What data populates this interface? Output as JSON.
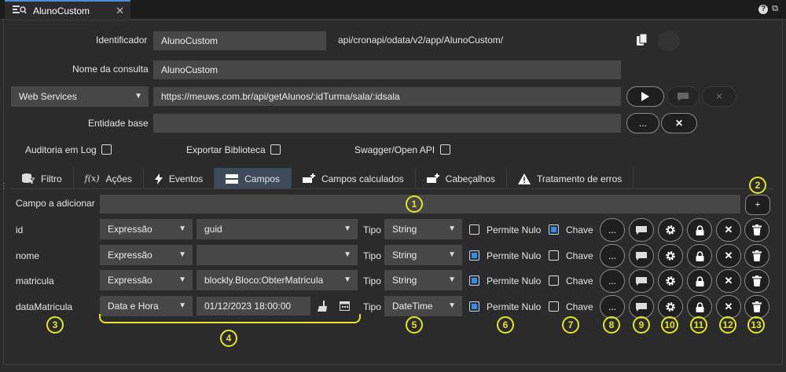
{
  "window": {
    "tab_title": "AlunoCustom",
    "help_icon": "help-icon",
    "external_icon": "external-link-icon"
  },
  "form": {
    "identificador_label": "Identificador",
    "identificador_value": "AlunoCustom",
    "api_path": "api/cronapi/odata/v2/app/AlunoCustom/",
    "nome_consulta_label": "Nome da consulta",
    "nome_consulta_value": "AlunoCustom",
    "source_type": "Web Services",
    "url_value": "https://meuws.com.br/api/getAlunos/:idTurma/sala/:idsala",
    "entidade_label": "Entidade base",
    "entidade_value": "",
    "ellipsis_label": "...",
    "auditoria_label": "Auditoria em Log",
    "exportar_label": "Exportar Biblioteca",
    "swagger_label": "Swagger/Open API"
  },
  "tabs": [
    {
      "label": "Filtro",
      "icon": "database-filter-icon"
    },
    {
      "label": "Ações",
      "icon": "function-icon"
    },
    {
      "label": "Eventos",
      "icon": "lightning-icon"
    },
    {
      "label": "Campos",
      "icon": "fields-icon"
    },
    {
      "label": "Campos calculados",
      "icon": "add-field-icon"
    },
    {
      "label": "Cabeçalhos",
      "icon": "add-header-icon"
    },
    {
      "label": "Tratamento de erros",
      "icon": "warning-icon"
    }
  ],
  "campos": {
    "add_label": "Campo a adicionar",
    "add_button": "+",
    "tipo_label": "Tipo",
    "permite_nulo_label": "Permite Nulo",
    "chave_label": "Chave",
    "ellipsis_label": "...",
    "rows": [
      {
        "name": "id",
        "source": "Expressão",
        "expression": "guid",
        "type": "String",
        "nullable": false,
        "key": true
      },
      {
        "name": "nome",
        "source": "Expressão",
        "expression": "",
        "type": "String",
        "nullable": true,
        "key": false
      },
      {
        "name": "matricula",
        "source": "Expressão",
        "expression": "blockly.Bloco:ObterMatricula",
        "type": "String",
        "nullable": true,
        "key": false
      },
      {
        "name": "dataMatricula",
        "source": "Data e Hora",
        "expression": "01/12/2023 18:00:00",
        "type": "DateTime",
        "nullable": true,
        "key": false
      }
    ]
  },
  "callouts": [
    "1",
    "2",
    "3",
    "4",
    "5",
    "6",
    "7",
    "8",
    "9",
    "10",
    "11",
    "12",
    "13"
  ],
  "colors": {
    "accent": "#3b8be0",
    "callout": "#e5e52a",
    "active_tab": "#3c4a5a"
  }
}
